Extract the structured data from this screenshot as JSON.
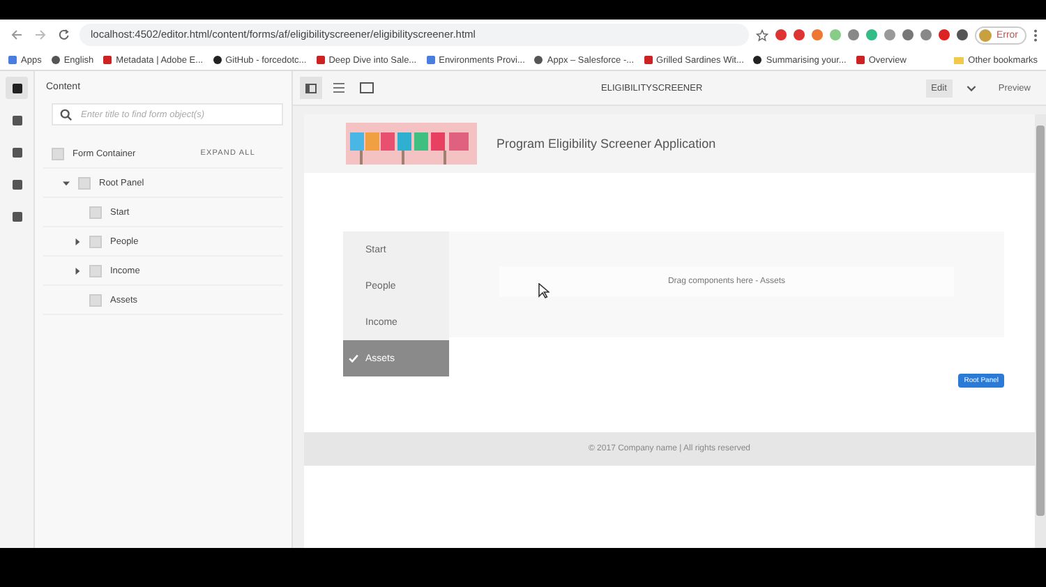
{
  "browser": {
    "url": "localhost:4502/editor.html/content/forms/af/eligibilityscreener/eligibilityscreener.html",
    "profile": "Error",
    "bookmarks": [
      "Apps",
      "English",
      "Metadata | Adobe E...",
      "GitHub - forcedotc...",
      "Deep Dive into Sale...",
      "Environments Provi...",
      "Appx – Salesforce -...",
      "Grilled Sardines Wit...",
      "Summarising your...",
      "Overview"
    ],
    "other_bookmarks": "Other bookmarks"
  },
  "rail": [
    {
      "selected": true
    },
    {
      "selected": false
    },
    {
      "selected": false
    },
    {
      "selected": false
    },
    {
      "selected": false
    }
  ],
  "panel": {
    "title": "Content",
    "search": {
      "placeholder": "Enter title to find form object(s)"
    },
    "root": "Form Container",
    "expand_all": "EXPAND ALL",
    "tree": [
      {
        "label": "Root Panel",
        "expanded": true,
        "children": [
          {
            "label": "Start",
            "expandable": false
          },
          {
            "label": "People",
            "expandable": true
          },
          {
            "label": "Income",
            "expandable": true
          },
          {
            "label": "Assets",
            "expandable": false
          }
        ]
      }
    ]
  },
  "editor": {
    "title": "ELIGIBILITYSCREENER",
    "mode": "Edit",
    "preview": "Preview"
  },
  "page": {
    "heading": "Program Eligibility Screener Application",
    "steps": [
      {
        "label": "Start",
        "selected": false
      },
      {
        "label": "People",
        "selected": false
      },
      {
        "label": "Income",
        "selected": false
      },
      {
        "label": "Assets",
        "selected": true
      }
    ],
    "dropzone": "Drag components here - Assets",
    "badge": "Root Panel",
    "footer": "© 2017 Company name | All rights reserved"
  }
}
